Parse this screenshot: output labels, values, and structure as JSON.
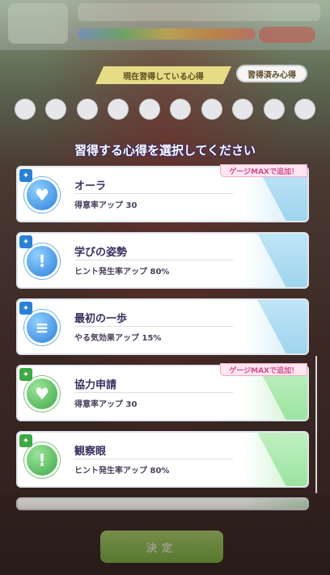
{
  "header": {
    "current_label": "現在習得している心得",
    "learned_button": "習得済み心得"
  },
  "slots_count": 10,
  "heading": "習得する心得を選択してください",
  "items": [
    {
      "name": "オーラ",
      "effect": "得意率アップ 30",
      "color": "blue",
      "badge": "ゲージMAXで追加！",
      "icon": "rabbit-icon"
    },
    {
      "name": "学びの姿勢",
      "effect": "ヒント発生率アップ 80%",
      "color": "blue",
      "badge": "",
      "icon": "exclamation-icon"
    },
    {
      "name": "最初の一歩",
      "effect": "やる気効果アップ 15%",
      "color": "blue",
      "badge": "",
      "icon": "dumbbell-icon"
    },
    {
      "name": "協力申請",
      "effect": "得意率アップ 30",
      "color": "green",
      "badge": "ゲージMAXで追加！",
      "icon": "rabbit-icon"
    },
    {
      "name": "観察眼",
      "effect": "ヒント発生率アップ 80%",
      "color": "green",
      "badge": "",
      "icon": "exclamation-icon"
    }
  ],
  "decide_button": "決定",
  "icon_glyphs": {
    "rabbit-icon": "♥",
    "exclamation-icon": "!",
    "dumbbell-icon": "≡"
  },
  "colors": {
    "blue": "#2d7fd8",
    "green": "#3ea845",
    "badge_text": "#d34a8b"
  }
}
